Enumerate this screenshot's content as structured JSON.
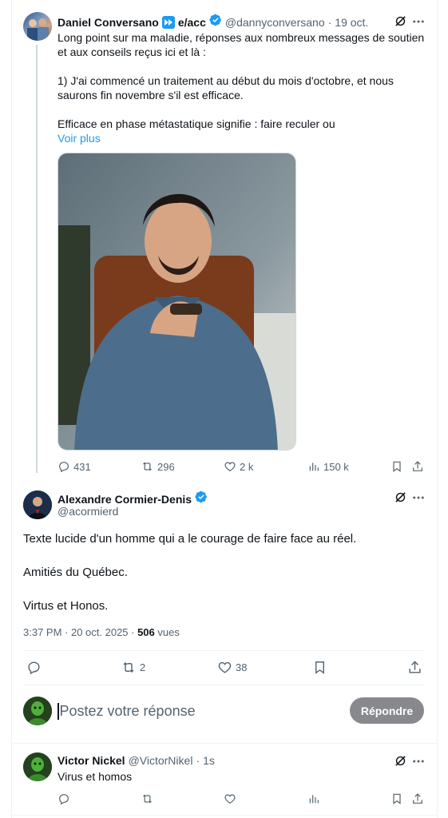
{
  "tweet1": {
    "author_name": "Daniel Conversano",
    "author_suffix": "e/acc",
    "handle": "@dannyconversano",
    "dot": "·",
    "date": "19 oct.",
    "text_line1": "Long point sur ma maladie, réponses aux nombreux messages de soutien",
    "text_line2": "et aux conseils reçus ici et là :",
    "text_line3": "1) J'ai commencé un traitement au début du mois d'octobre, et nous",
    "text_line4": "saurons fin novembre s'il est efficace.",
    "text_line5": "Efficace en phase métastatique signifie : faire reculer ou",
    "show_more": "Voir plus",
    "stats": {
      "replies": "431",
      "retweets": "296",
      "likes": "2 k",
      "views": "150 k"
    }
  },
  "tweet2": {
    "author_name": "Alexandre Cormier-Denis",
    "handle": "@acormierd",
    "paragraph1": "Texte lucide d'un homme qui a le courage de faire face au réel.",
    "paragraph2": "Amitiés du Québec.",
    "paragraph3": "Virtus et Honos.",
    "timestamp": "3:37 PM · 20 oct. 2025 · ",
    "views_count": "506",
    "views_label": " vues",
    "stats": {
      "retweets": "2",
      "likes": "38"
    }
  },
  "reply_box": {
    "placeholder": "Postez votre réponse",
    "button": "Répondre"
  },
  "tweet3": {
    "author_name": "Victor Nickel",
    "handle": "@VictorNikel",
    "dot": "·",
    "date": "1s",
    "text": "Virus et homos"
  },
  "colors": {
    "accent": "#1d9bf0",
    "muted": "#536471",
    "border": "#eff3f4",
    "button_disabled": "#87898c"
  },
  "icons": [
    "grok-icon",
    "more-icon",
    "reply-icon",
    "retweet-icon",
    "like-icon",
    "views-icon",
    "bookmark-icon",
    "share-icon",
    "verified-badge-icon",
    "fast-forward-emoji-icon"
  ]
}
